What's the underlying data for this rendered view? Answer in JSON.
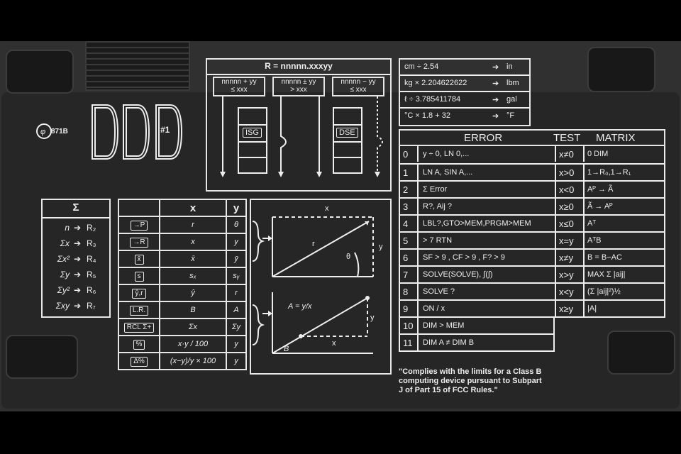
{
  "logo": {
    "code": "871B"
  },
  "drives": {
    "label": "#1"
  },
  "loop": {
    "header": "R = nnnnn.xxxyy",
    "isg_cond_1": "nnnnn + yy",
    "isg_cond_2": "≤ xxx",
    "mid_cond_1": "nnnnn ± yy",
    "mid_cond_2": "> xxx",
    "dse_cond_1": "nnnnn − yy",
    "dse_cond_2": "≤ xxx",
    "isg_label": "ISG",
    "dse_label": "DSE"
  },
  "conversions": [
    {
      "expr": "cm ÷ 2.54",
      "unit": "in"
    },
    {
      "expr": "kg × 2.204622622",
      "unit": "lbm"
    },
    {
      "expr": "ℓ ÷ 3.785411784",
      "unit": "gal"
    },
    {
      "expr": "°C × 1.8 + 32",
      "unit": "°F"
    }
  ],
  "sigma_table": {
    "header": "Σ",
    "rows": [
      {
        "item": "n",
        "reg": "R₂"
      },
      {
        "item": "Σx",
        "reg": "R₃"
      },
      {
        "item": "Σx²",
        "reg": "R₄"
      },
      {
        "item": "Σy",
        "reg": "R₅"
      },
      {
        "item": "Σy²",
        "reg": "R₆"
      },
      {
        "item": "Σxy",
        "reg": "R₇"
      }
    ]
  },
  "stat_table": {
    "col_x": "x",
    "col_y": "y",
    "rows": [
      {
        "key": "→P",
        "x": "r",
        "y": "θ"
      },
      {
        "key": "→R",
        "x": "x",
        "y": "y"
      },
      {
        "key": "x̄",
        "x": "x̄",
        "y": "ȳ"
      },
      {
        "key": "s",
        "x": "sₓ",
        "y": "sᵧ"
      },
      {
        "key": "ŷ,r",
        "x": "ŷ",
        "y": "r"
      },
      {
        "key": "L.R.",
        "x": "B",
        "y": "A"
      },
      {
        "key": "RCL Σ+",
        "x": "Σx",
        "y": "Σy"
      },
      {
        "key": "%",
        "x": "x·y / 100",
        "y": "y"
      },
      {
        "key": "Δ%",
        "x": "(x−y)/y × 100",
        "y": "y"
      }
    ]
  },
  "diagram": {
    "polar_x": "x",
    "polar_y": "y",
    "polar_r": "r",
    "polar_theta": "θ",
    "line_eq": "A = y/x",
    "line_y": "y",
    "line_x": "x",
    "line_b": "B"
  },
  "error_matrix": {
    "title_error": "ERROR",
    "title_test": "TEST",
    "title_matrix": "MATRIX",
    "rows": [
      {
        "n": "0",
        "error": "y ÷ 0, LN 0,...",
        "test": "x≠0",
        "matrix": "0 DIM"
      },
      {
        "n": "1",
        "error": "LN A, SIN A,...",
        "test": "x>0",
        "matrix": "1→R₀,1→R₁"
      },
      {
        "n": "2",
        "error": "Σ Error",
        "test": "x<0",
        "matrix": "Aᴾ → Ã"
      },
      {
        "n": "3",
        "error": "R?, Aij ?",
        "test": "x≥0",
        "matrix": "Ã → Aᴾ"
      },
      {
        "n": "4",
        "error": "LBL?,GTO>MEM,PRGM>MEM",
        "test": "x≤0",
        "matrix": "Aᵀ"
      },
      {
        "n": "5",
        "error": "> 7 RTN",
        "test": "x=y",
        "matrix": "AᵀB"
      },
      {
        "n": "6",
        "error": "SF > 9 , CF > 9 , F? > 9",
        "test": "x≠y",
        "matrix": "B = B−AC"
      },
      {
        "n": "7",
        "error": "SOLVE(SOLVE), ∫(∫)",
        "test": "x>y",
        "matrix": "MAX Σ |aij|"
      },
      {
        "n": "8",
        "error": "SOLVE ?",
        "test": "x<y",
        "matrix": "(Σ |aij|²)½"
      },
      {
        "n": "9",
        "error": "ON / x",
        "test": "x≥y",
        "matrix": "|A|"
      },
      {
        "n": "10",
        "error": "DIM > MEM"
      },
      {
        "n": "11",
        "error": "DIM A ≠ DIM B"
      }
    ]
  },
  "fcc": {
    "line1": "\"Complies with the limits for a Class B",
    "line2": "computing device pursuant to Subpart",
    "line3": "J of Part 15 of FCC Rules.\""
  }
}
